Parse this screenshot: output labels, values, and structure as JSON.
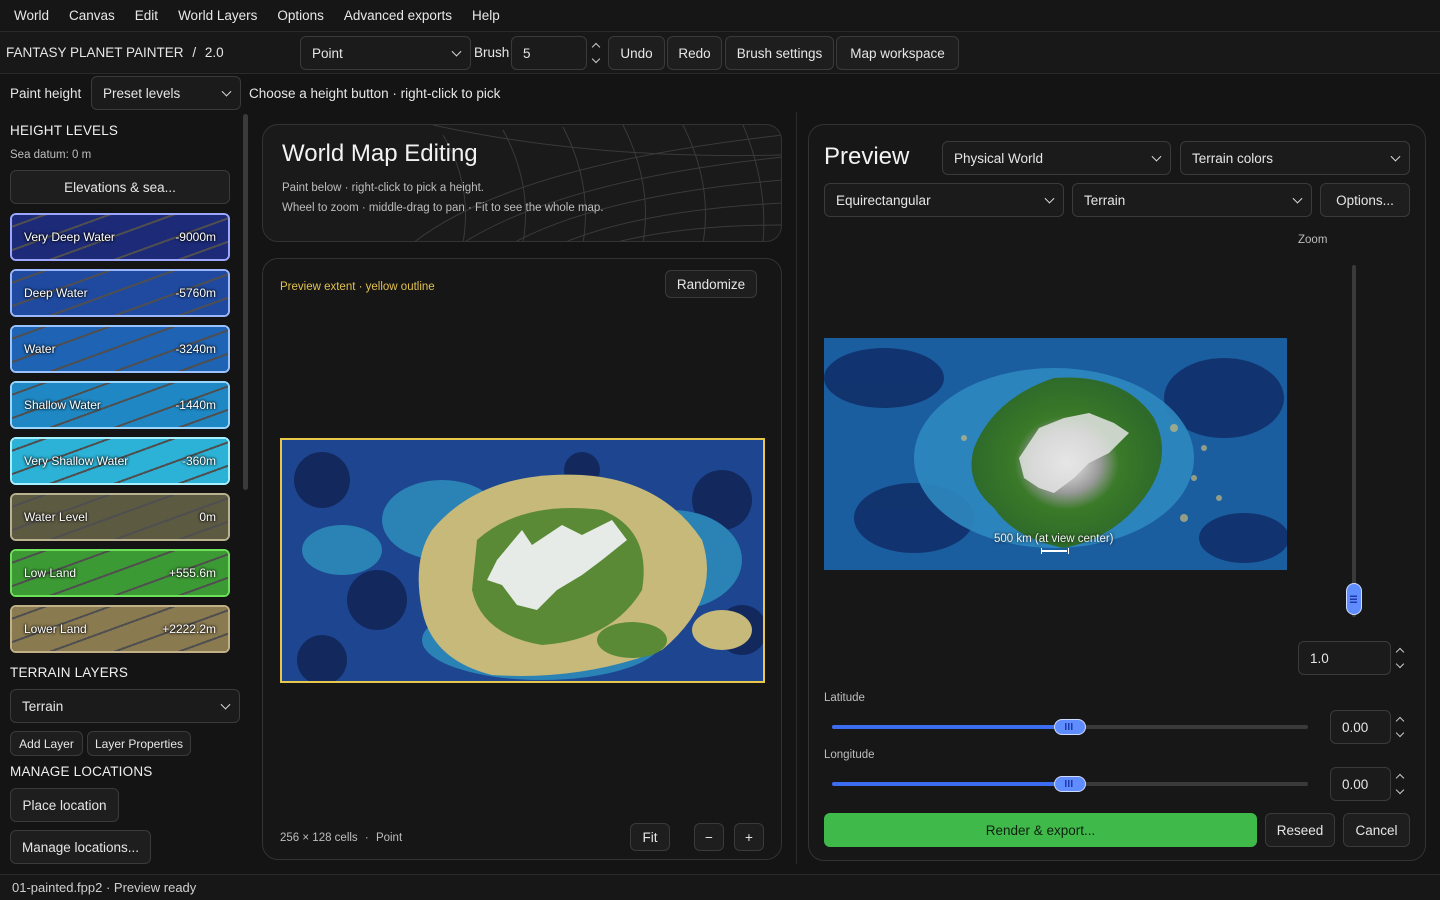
{
  "menu": [
    "World",
    "Canvas",
    "Edit",
    "World Layers",
    "Options",
    "Advanced exports",
    "Help"
  ],
  "app": {
    "title": "FANTASY PLANET PAINTER",
    "separator": "/",
    "version": "2.0"
  },
  "toolbar": {
    "tool_value": "Point",
    "brush_label": "Brush",
    "brush_value": "5",
    "undo": "Undo",
    "redo": "Redo",
    "brush_settings": "Brush settings",
    "map_workspace": "Map workspace"
  },
  "paint_bar": {
    "label": "Paint height",
    "mode_value": "Preset levels",
    "hint": "Choose a height button · right-click to pick"
  },
  "sidebar": {
    "height_levels_title": "HEIGHT LEVELS",
    "sea_datum": "Sea datum: 0 m",
    "elevations_button": "Elevations & sea...",
    "levels": [
      {
        "name": "Very Deep Water",
        "value": "-9000m",
        "color": "#1c2a78"
      },
      {
        "name": "Deep Water",
        "value": "-5760m",
        "color": "#1f4aa0"
      },
      {
        "name": "Water",
        "value": "-3240m",
        "color": "#1e63b4"
      },
      {
        "name": "Shallow Water",
        "value": "-1440m",
        "color": "#1f88c4"
      },
      {
        "name": "Very Shallow Water",
        "value": "-360m",
        "color": "#2bb2d6"
      },
      {
        "name": "Water Level",
        "value": "0m",
        "color": "#5d5a42"
      },
      {
        "name": "Low Land",
        "value": "+555.6m",
        "color": "#3c9a34"
      },
      {
        "name": "Lower Land",
        "value": "+2222.2m",
        "color": "#8a7a50"
      }
    ],
    "terrain_layers_title": "TERRAIN LAYERS",
    "terrain_value": "Terrain",
    "add_layer": "Add Layer",
    "layer_properties": "Layer Properties",
    "manage_locations_title": "MANAGE LOCATIONS",
    "place_location": "Place location",
    "manage_locations": "Manage locations..."
  },
  "editor": {
    "title": "World Map Editing",
    "hint1": "Paint below · right-click to pick a height.",
    "hint2": "Wheel to zoom · middle-drag to pan · Fit to see the whole map.",
    "extent_note": "Preview extent · yellow outline",
    "randomize": "Randomize",
    "grid_info": "256 × 128 cells",
    "grid_sep": "·",
    "grid_tool": "Point",
    "fit": "Fit",
    "zoom_out": "−",
    "zoom_in": "+"
  },
  "preview": {
    "title": "Preview",
    "world_value": "Physical World",
    "colors_value": "Terrain colors",
    "projection_value": "Equirectangular",
    "layer_value": "Terrain",
    "options": "Options...",
    "zoom_label": "Zoom",
    "zoom_value": "1.0",
    "zoom_level": 0.05,
    "scale_text": "500 km (at view center)",
    "latitude_label": "Latitude",
    "latitude_value": "0.00",
    "latitude_fraction": 0.5,
    "longitude_label": "Longitude",
    "longitude_value": "0.00",
    "longitude_fraction": 0.5,
    "render": "Render & export...",
    "reseed": "Reseed",
    "cancel": "Cancel"
  },
  "status": {
    "text": "01-painted.fpp2 · Preview ready"
  },
  "colors": {
    "accent_green": "#3fba4a",
    "accent_blue": "#3c6cf0",
    "outline_yellow": "#e8c84a"
  }
}
